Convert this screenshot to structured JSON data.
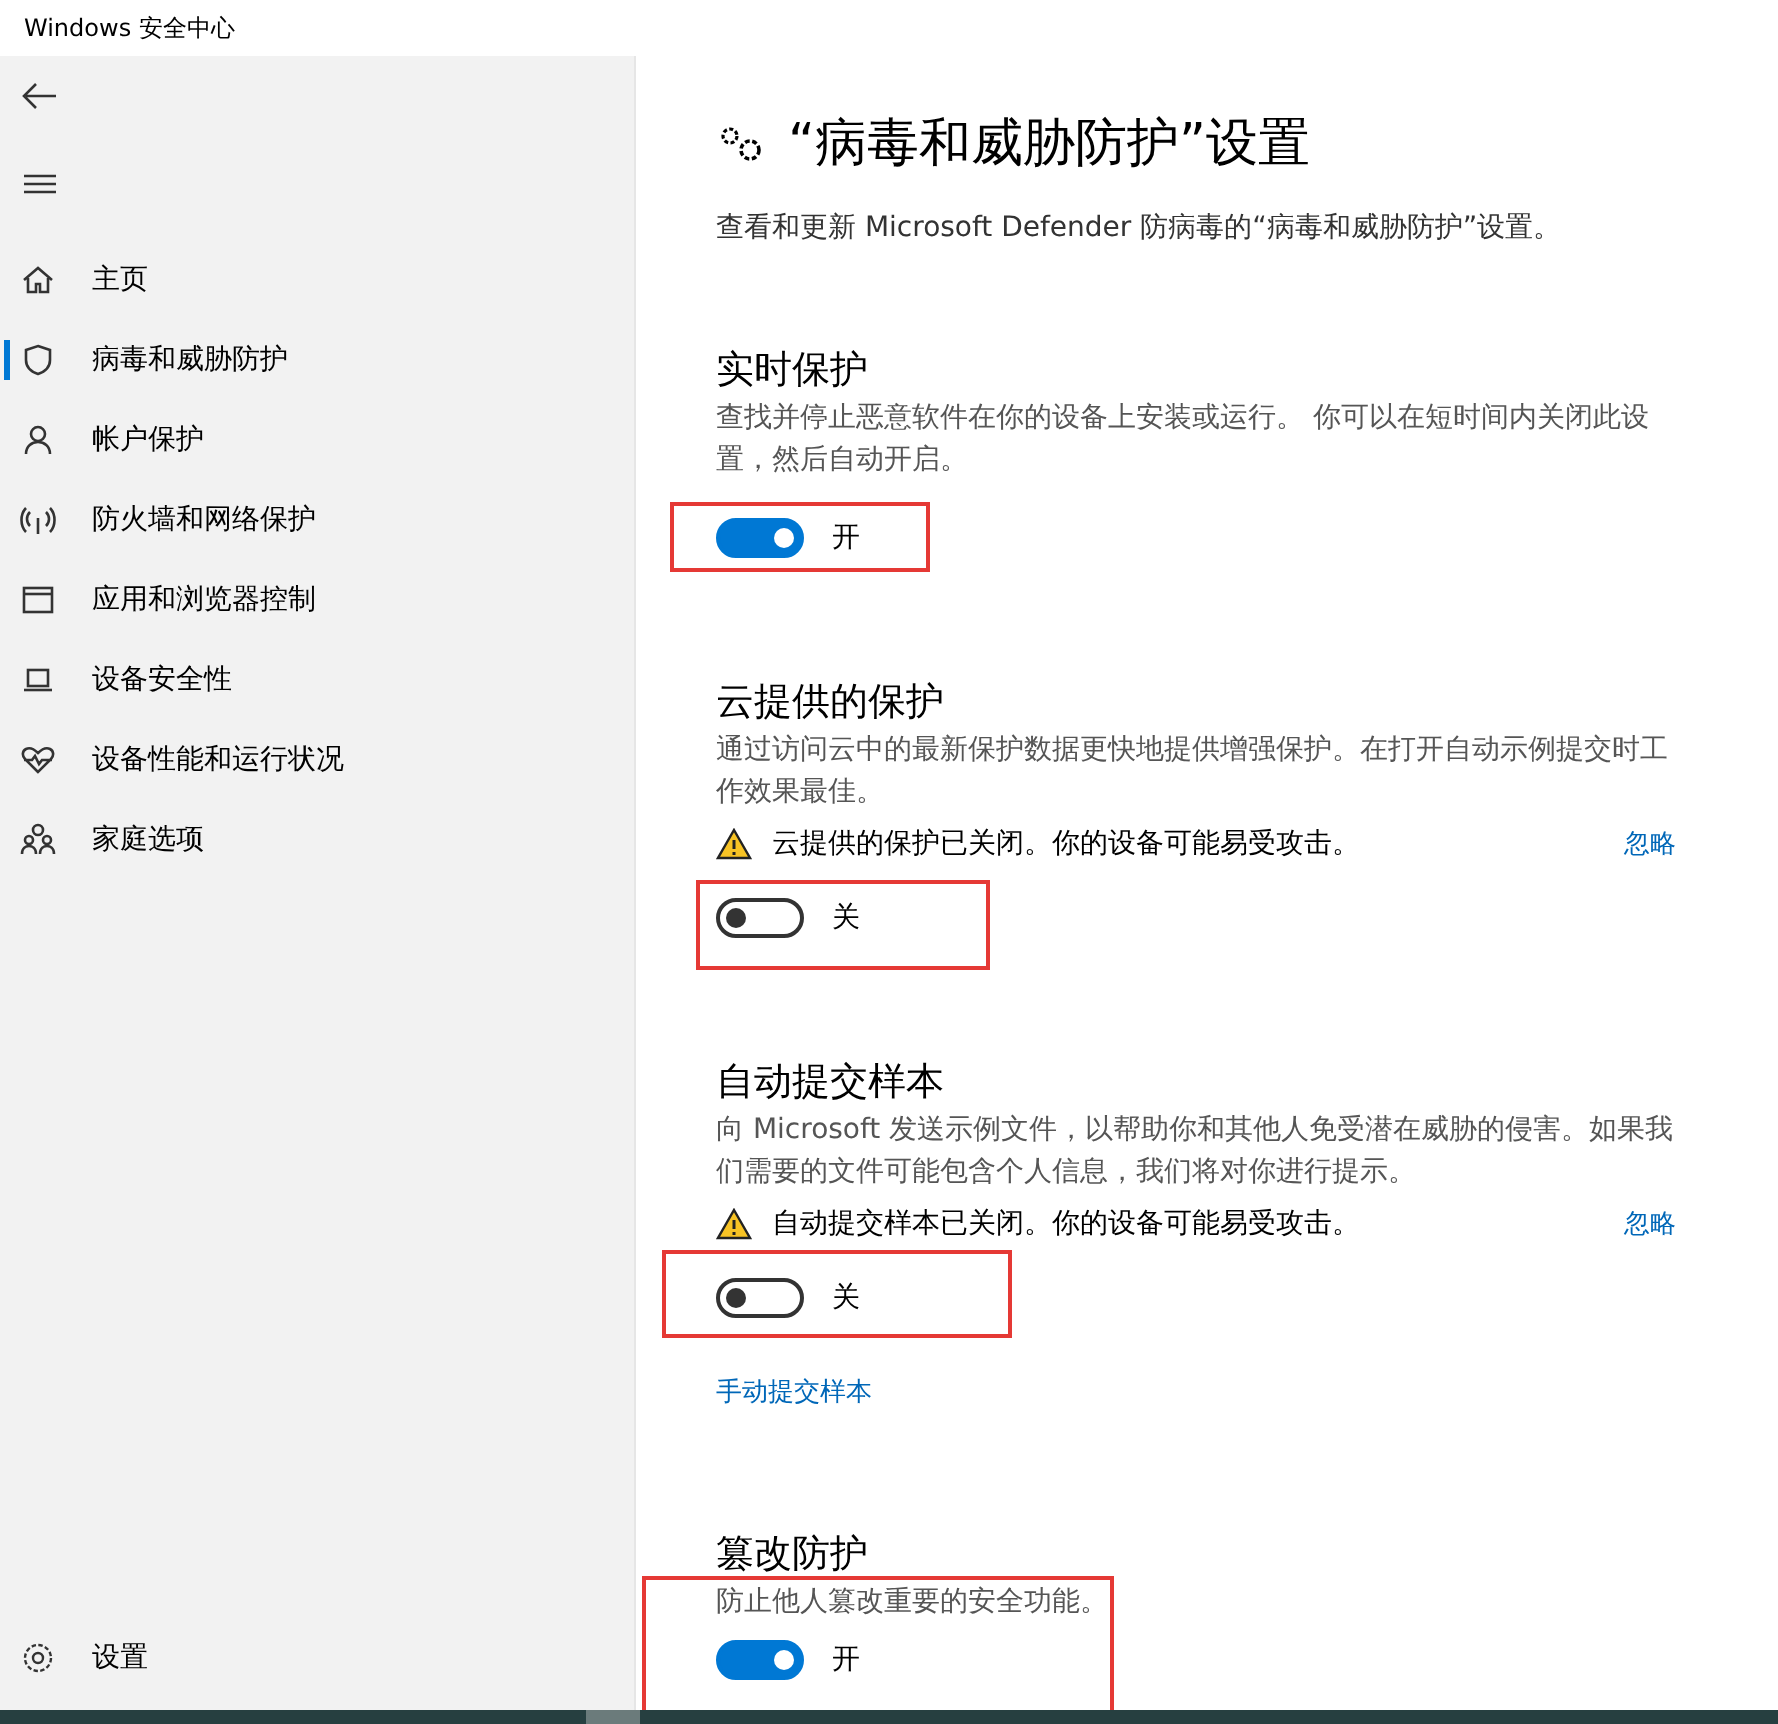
{
  "window": {
    "title": "Windows 安全中心"
  },
  "sidebar": {
    "items": [
      {
        "kind": "home",
        "label": "主页",
        "selected": false
      },
      {
        "kind": "shield",
        "label": "病毒和威胁防护",
        "selected": true
      },
      {
        "kind": "person",
        "label": "帐户保护",
        "selected": false
      },
      {
        "kind": "wifi",
        "label": "防火墙和网络保护",
        "selected": false
      },
      {
        "kind": "window",
        "label": "应用和浏览器控制",
        "selected": false
      },
      {
        "kind": "laptop",
        "label": "设备安全性",
        "selected": false
      },
      {
        "kind": "heart",
        "label": "设备性能和运行状况",
        "selected": false
      },
      {
        "kind": "family",
        "label": "家庭选项",
        "selected": false
      }
    ],
    "settings": {
      "label": "设置"
    }
  },
  "page": {
    "title": "“病毒和威胁防护”设置",
    "subtitle": "查看和更新 Microsoft Defender 防病毒的“病毒和威胁防护”设置。"
  },
  "sections": [
    {
      "heading": "实时保护",
      "description": "查找并停止恶意软件在你的设备上安装或运行。 你可以在短时间内关闭此设置，然后自动开启。",
      "toggle": {
        "on": true,
        "label": "开"
      },
      "highlighted": true
    },
    {
      "heading": "云提供的保护",
      "description": "通过访问云中的最新保护数据更快地提供增强保护。在打开自动示例提交时工作效果最佳。",
      "warning": {
        "text": "云提供的保护已关闭。你的设备可能易受攻击。",
        "action": "忽略"
      },
      "toggle": {
        "on": false,
        "label": "关"
      },
      "highlighted": true
    },
    {
      "heading": "自动提交样本",
      "description": "向 Microsoft 发送示例文件，以帮助你和其他人免受潜在威胁的侵害。如果我们需要的文件可能包含个人信息，我们将对你进行提示。",
      "warning": {
        "text": "自动提交样本已关闭。你的设备可能易受攻击。",
        "action": "忽略"
      },
      "toggle": {
        "on": false,
        "label": "关"
      },
      "link": "手动提交样本",
      "highlighted": true
    },
    {
      "heading": "篡改防护",
      "description": "防止他人篡改重要的安全功能。",
      "toggle": {
        "on": true,
        "label": "开"
      },
      "highlighted": true
    }
  ]
}
